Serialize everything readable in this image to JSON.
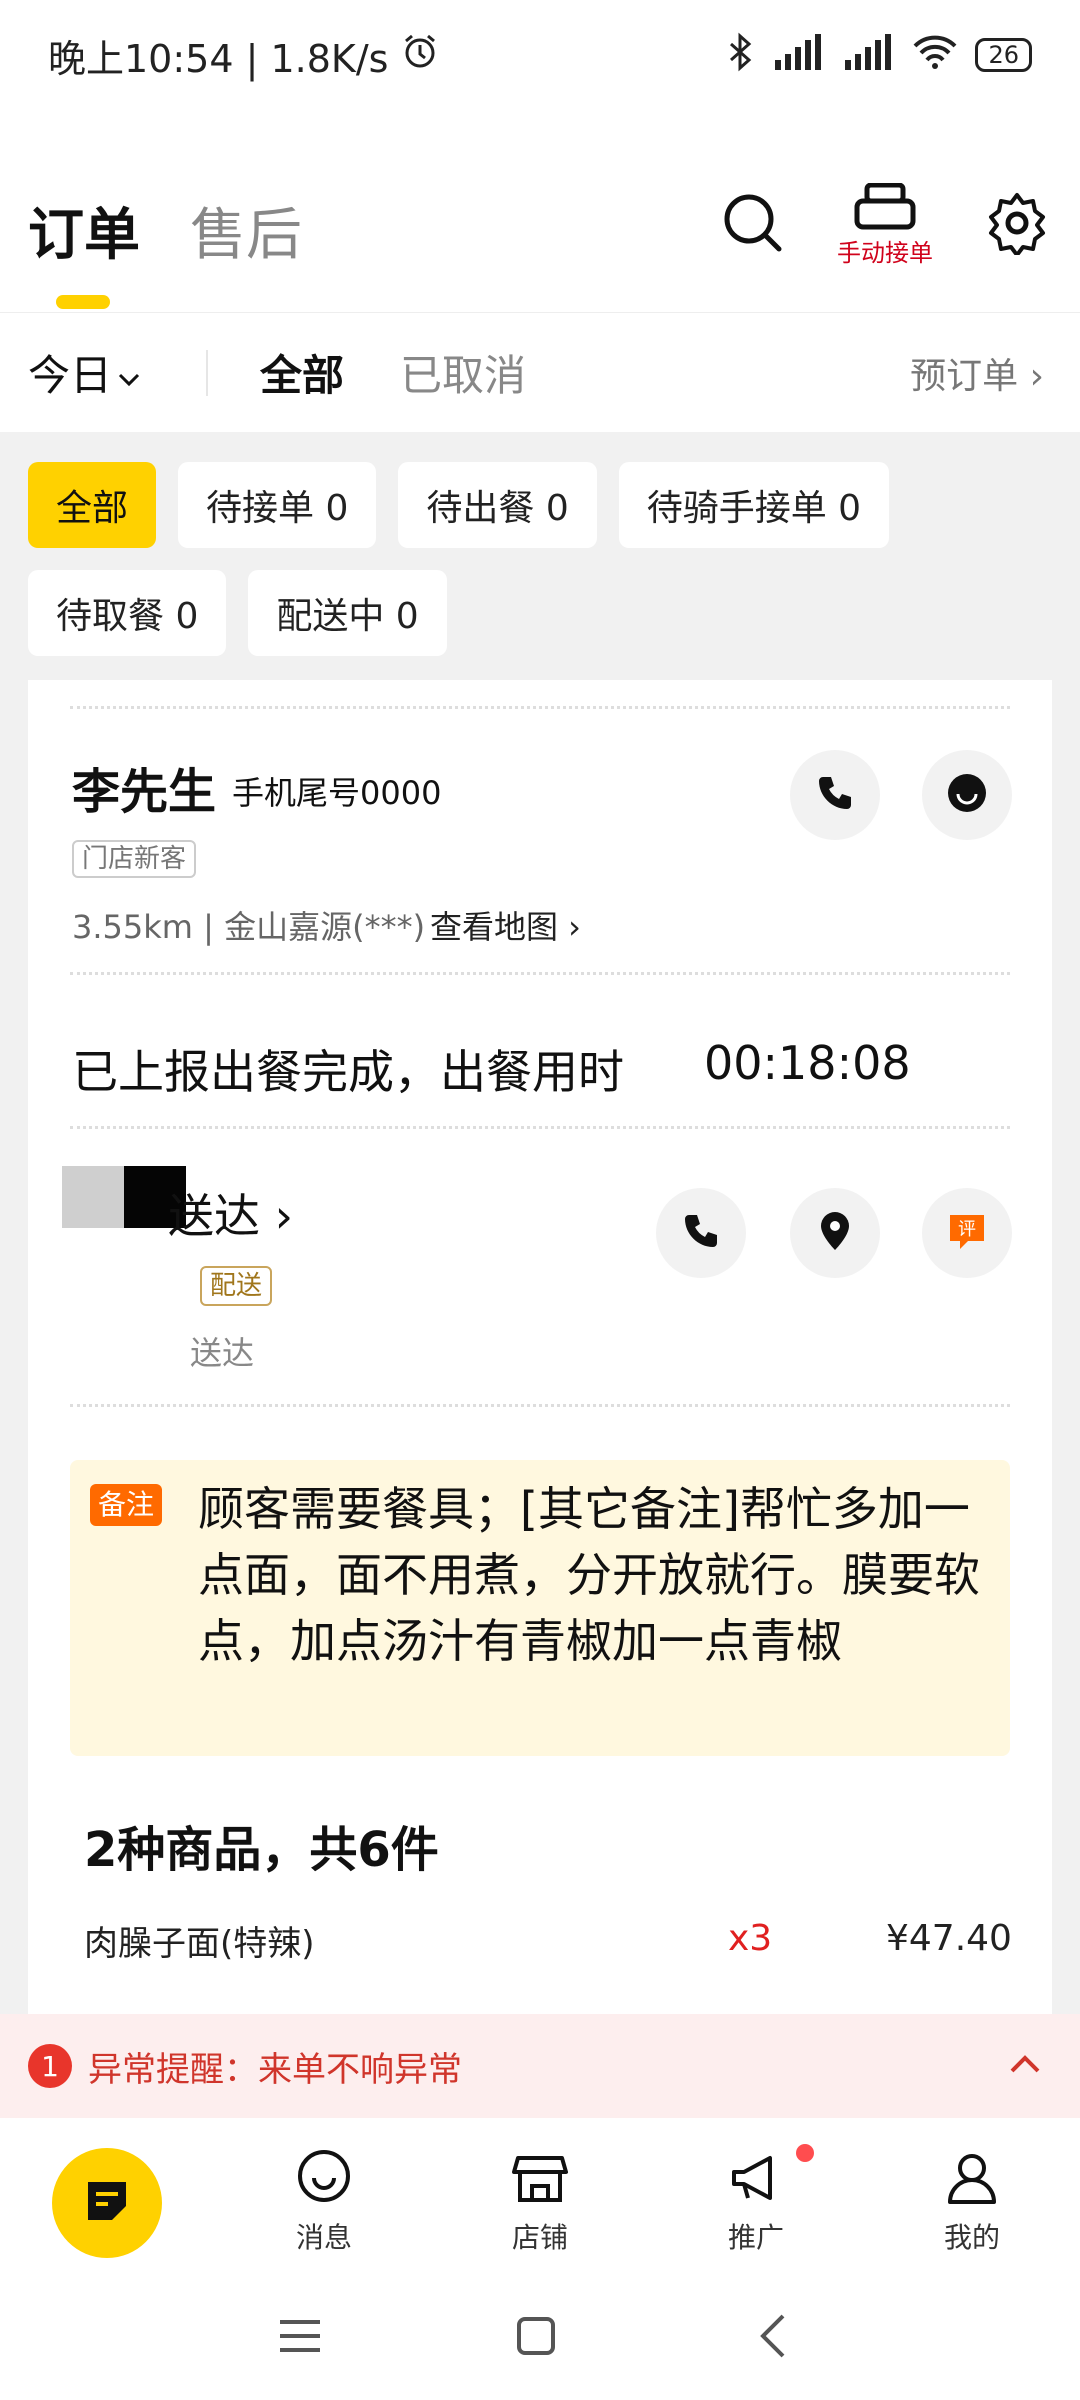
{
  "status_bar": {
    "time_speed": "晚上10:54 | 1.8K/s",
    "battery": "26",
    "icons": [
      "alarm-icon",
      "bluetooth-icon",
      "signal-icon",
      "wifi-icon"
    ]
  },
  "top_nav": {
    "tabs": [
      {
        "label": "订单",
        "active": true
      },
      {
        "label": "售后",
        "active": false
      }
    ],
    "manual_accept_label": "手动接单",
    "icons": [
      "search-icon",
      "printer-icon",
      "settings-icon"
    ],
    "accent": "#ffd100"
  },
  "filter_bar": {
    "date_label": "今日",
    "tabs": [
      {
        "label": "全部",
        "active": true
      },
      {
        "label": "已取消",
        "active": false
      }
    ],
    "preorder_label": "预订单 ›"
  },
  "chips": [
    {
      "label": "全部",
      "active": true
    },
    {
      "label": "待接单 0",
      "active": false
    },
    {
      "label": "待出餐 0",
      "active": false
    },
    {
      "label": "待骑手接单 0",
      "active": false
    },
    {
      "label": "待取餐 0",
      "active": false
    },
    {
      "label": "配送中 0",
      "active": false
    }
  ],
  "order": {
    "customer_name": "李先生",
    "phone_tail": "手机尾号0000",
    "customer_tag": "门店新客",
    "distance_address": "3.55km | 金山嘉源(***)",
    "view_map": "查看地图 ›",
    "meal_status": "已上报出餐完成，出餐用时",
    "meal_time": "00:18:08",
    "rider_status": "送达 ›",
    "rider_tag": "配送",
    "rider_sub": "送达",
    "note_tag": "备注",
    "note_text": "顾客需要餐具；[其它备注]帮忙多加一点面，面不用煮，分开放就行。膜要软点，加点汤汁有青椒加一点青椒",
    "items_summary": "2种商品，共6件",
    "items": [
      {
        "name": "肉臊子面(特辣)",
        "qty": "x3",
        "price": "¥47.40"
      }
    ]
  },
  "alert": {
    "count": "1",
    "text": "异常提醒：来单不响异常"
  },
  "bottom_nav": {
    "items": [
      {
        "label": "消息",
        "icon": "message-icon"
      },
      {
        "label": "店铺",
        "icon": "store-icon"
      },
      {
        "label": "推广",
        "icon": "megaphone-icon"
      },
      {
        "label": "我的",
        "icon": "profile-icon"
      }
    ]
  },
  "system_nav": [
    "menu-icon",
    "home-icon",
    "back-icon"
  ]
}
